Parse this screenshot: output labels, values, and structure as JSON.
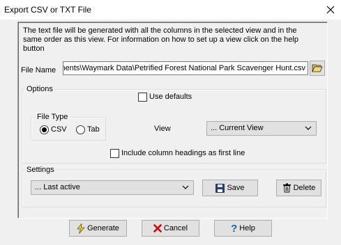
{
  "window": {
    "title": "Export CSV or TXT File"
  },
  "info_text": "The text file will be generated with all the columns in the selected view and in the same order as this view. For information on how to set up a view click on the help button",
  "file_name": {
    "label": "File Name",
    "value": "nents\\Waymark Data\\Petrified Forest National Park Scavenger Hunt.csv"
  },
  "options": {
    "legend": "Options",
    "use_defaults_label": "Use defaults",
    "use_defaults_checked": false,
    "file_type": {
      "legend": "File Type",
      "csv_label": "CSV",
      "tab_label": "Tab",
      "selected": "CSV"
    },
    "view_label": "View",
    "view_value": "... Current View",
    "include_headings_label": "Include column headings as first line",
    "include_headings_checked": false
  },
  "settings": {
    "legend": "Settings",
    "selected": "... Last active",
    "save_label": "Save",
    "delete_label": "Delete"
  },
  "buttons": {
    "generate_label": "Generate",
    "cancel_label": "Cancel",
    "help_label": "Help"
  },
  "icons": {
    "close": "close-icon",
    "browse": "folder-open-icon",
    "save": "floppy-disk-icon",
    "delete": "trash-icon",
    "generate": "lightning-icon",
    "cancel": "red-x-icon",
    "help": "question-mark-icon"
  }
}
